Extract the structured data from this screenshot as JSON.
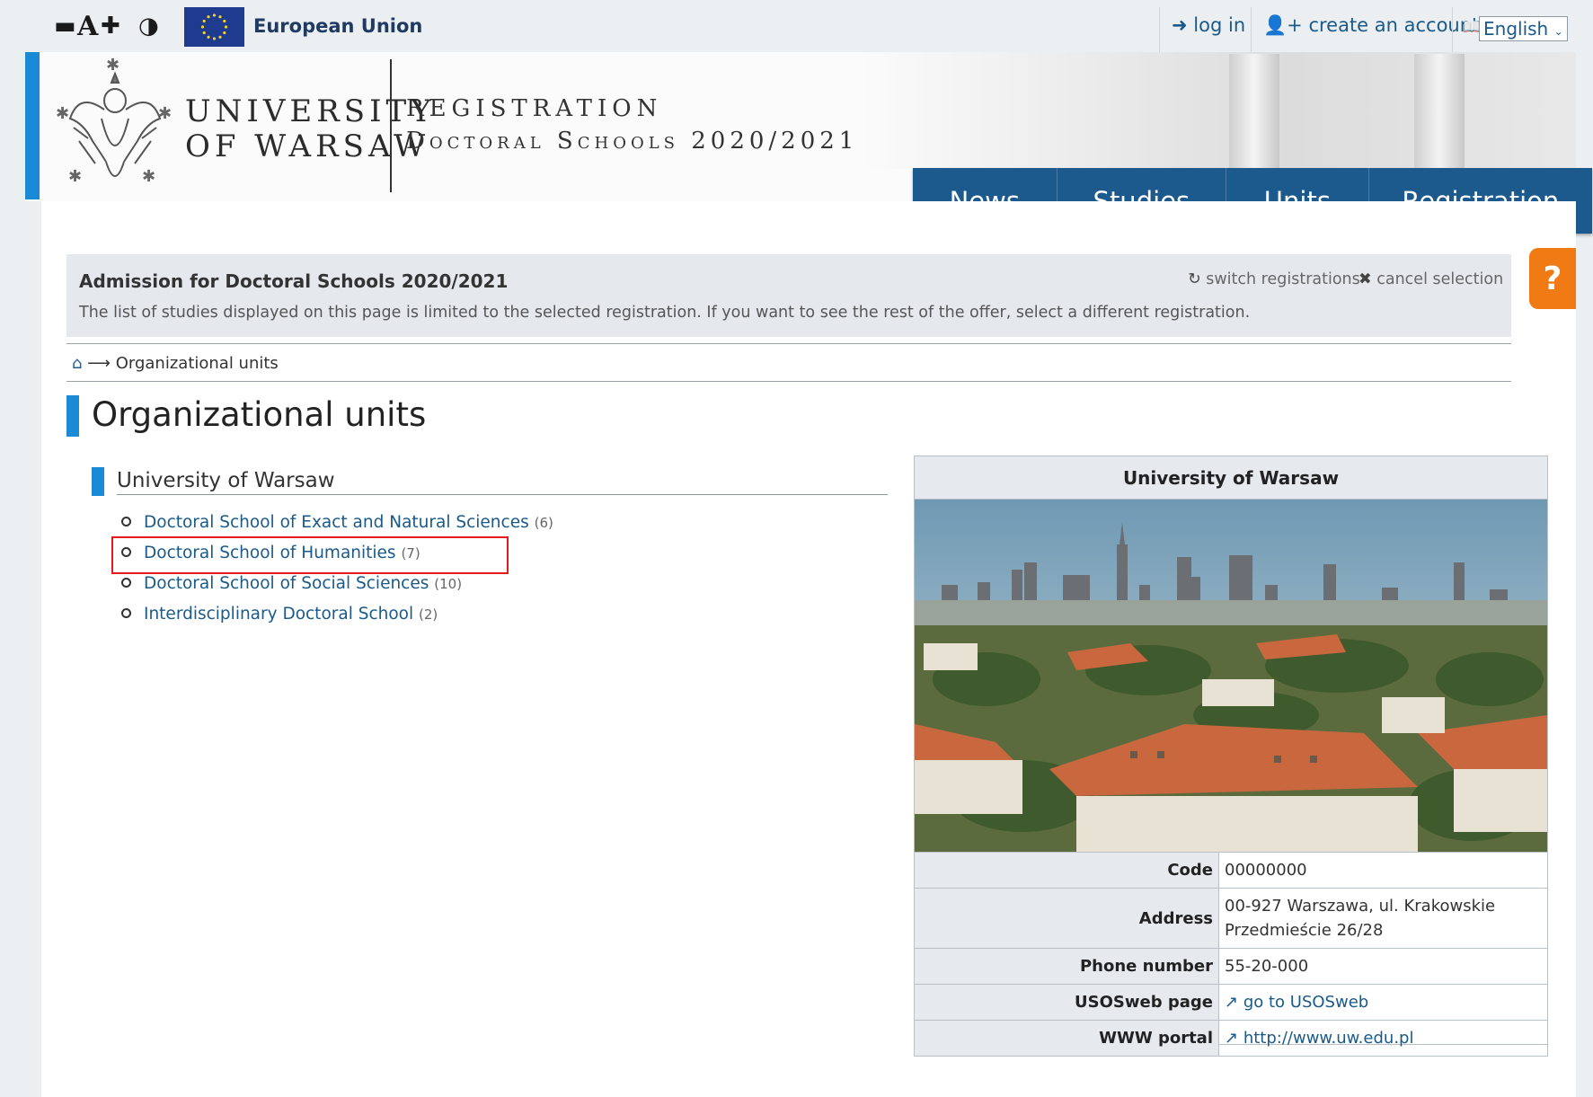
{
  "accessibility": {
    "decrease": "▬",
    "font": "A",
    "increase": "✚",
    "contrast": "◑"
  },
  "top": {
    "eu_label": "European Union",
    "login": "log in",
    "create_account": "create an account",
    "language": "English"
  },
  "header": {
    "uni_line1": "UNIVERSITY",
    "uni_line2": "OF WARSAW",
    "reg_line1": "REGISTRATION",
    "reg_line2": "Doctoral Schools 2020/2021"
  },
  "nav": [
    "News",
    "Studies",
    "Units",
    "Registration"
  ],
  "notice": {
    "title": "Admission for Doctoral Schools 2020/2021",
    "text": "The list of studies displayed on this page is limited to the selected registration. If you want to see the rest of the offer, select a different registration.",
    "switch": "switch registrations",
    "cancel": "cancel selection"
  },
  "help_label": "?",
  "breadcrumb": {
    "current": "Organizational units"
  },
  "page_title": "Organizational units",
  "unit": {
    "title": "University of Warsaw",
    "schools": [
      {
        "name": "Doctoral School of Exact and Natural Sciences",
        "count": "(6)"
      },
      {
        "name": "Doctoral School of Humanities",
        "count": "(7)"
      },
      {
        "name": "Doctoral School of Social Sciences",
        "count": "(10)"
      },
      {
        "name": "Interdisciplinary Doctoral School",
        "count": "(2)"
      }
    ]
  },
  "card": {
    "title": "University of Warsaw",
    "code_label": "Code",
    "code": "00000000",
    "address_label": "Address",
    "address": "00-927 Warszawa, ul. Krakowskie Przedmieście 26/28",
    "phone_label": "Phone number",
    "phone": "55-20-000",
    "usosweb_label": "USOSweb page",
    "usosweb": "go to USOSweb",
    "www_label": "WWW portal",
    "www": "http://www.uw.edu.pl"
  },
  "colors": {
    "accent": "#1a8ad6",
    "nav": "#1c5a8e",
    "help": "#f07a14",
    "highlight": "#e31b1b",
    "link": "#1a5a8a"
  }
}
